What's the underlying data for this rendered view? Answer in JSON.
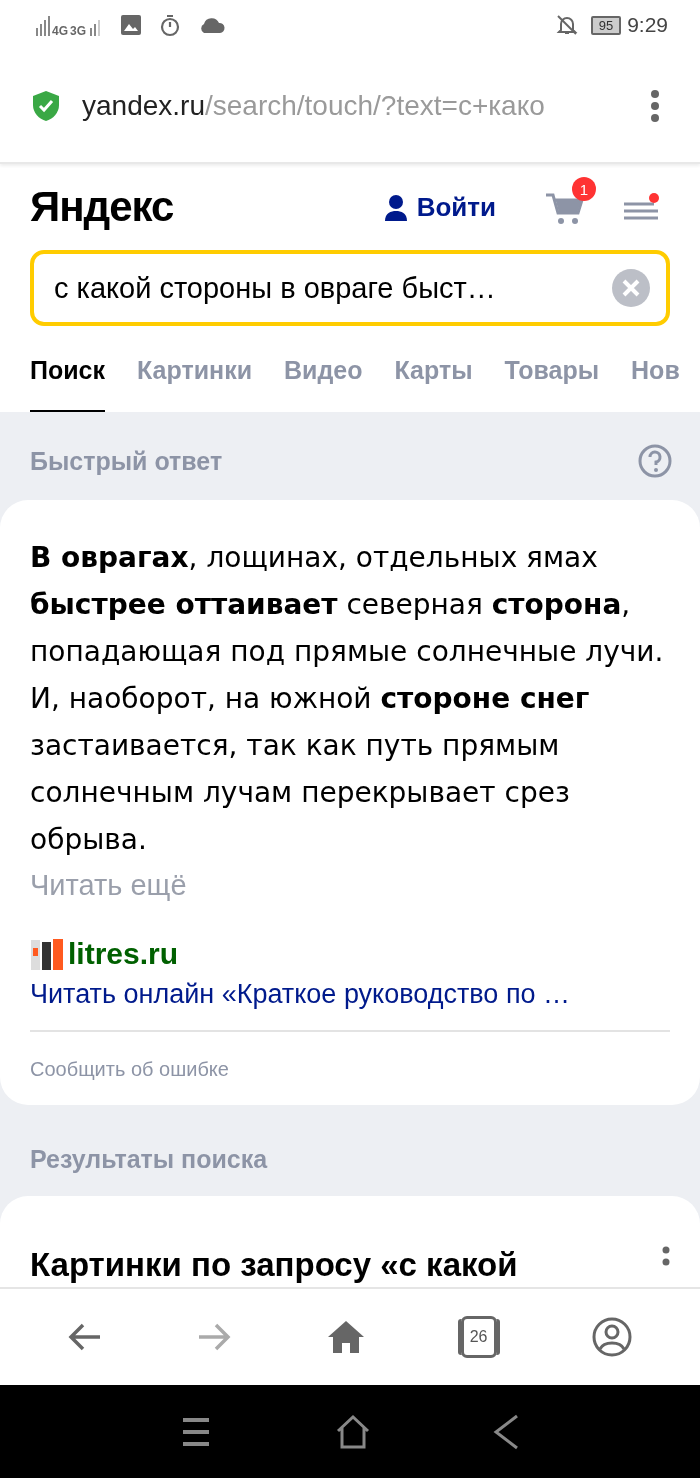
{
  "status_bar": {
    "network_1": "4G",
    "network_2": "3G",
    "battery": "95",
    "time": "9:29"
  },
  "address_bar": {
    "domain": "yandex.ru",
    "path": "/search/touch/?text=с+како"
  },
  "header": {
    "logo": "Яндекс",
    "login": "Войти",
    "cart_count": "1"
  },
  "search": {
    "value": "с какой стороны в овраге быст…"
  },
  "tabs": [
    {
      "label": "Поиск",
      "selected": true
    },
    {
      "label": "Картинки",
      "selected": false
    },
    {
      "label": "Видео",
      "selected": false
    },
    {
      "label": "Карты",
      "selected": false
    },
    {
      "label": "Товары",
      "selected": false
    },
    {
      "label": "Нов",
      "selected": false
    }
  ],
  "quick_answer": {
    "title": "Быстрый ответ",
    "text": "**В оврагах**, лощинах, отдельных ямах **быстрее оттаивает** северная **сторона**, попадающая под прямые солнечные лучи. И, наоборот, на южной **стороне снег** застаивается, так как путь прямым солнечным лучам перекрывает срез обрыва.",
    "read_more": "Читать ещё",
    "source": "litres.ru",
    "source_link": "Читать онлайн «Краткое руководство по …",
    "report": "Сообщить об ошибке"
  },
  "results": {
    "title": "Результаты поиска",
    "first_heading": "Картинки по запросу «с какой"
  },
  "bottom_bar": {
    "tabs_count": "26"
  }
}
